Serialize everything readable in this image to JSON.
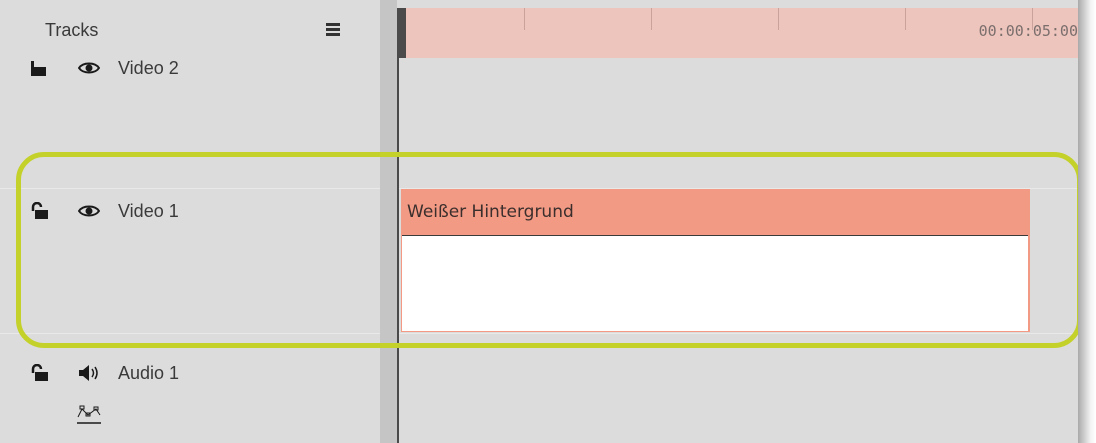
{
  "panel": {
    "title": "Tracks",
    "menu_icon": "hamburger-menu-icon"
  },
  "timeline": {
    "ruler_time": "00:00:05:00"
  },
  "tracks": [
    {
      "label": "Video 2",
      "lock_icon": "lock-icon",
      "visibility_icon": "eye-icon"
    },
    {
      "label": "Video 1",
      "lock_icon": "unlock-icon",
      "visibility_icon": "eye-icon"
    },
    {
      "label": "Audio 1",
      "lock_icon": "unlock-icon",
      "visibility_icon": "speaker-icon",
      "extra_icon": "keyframe-curve-icon"
    }
  ],
  "clip": {
    "title": "Weißer Hintergrund",
    "color": "#f29a84"
  },
  "highlight": {
    "color": "#c4d12b"
  }
}
